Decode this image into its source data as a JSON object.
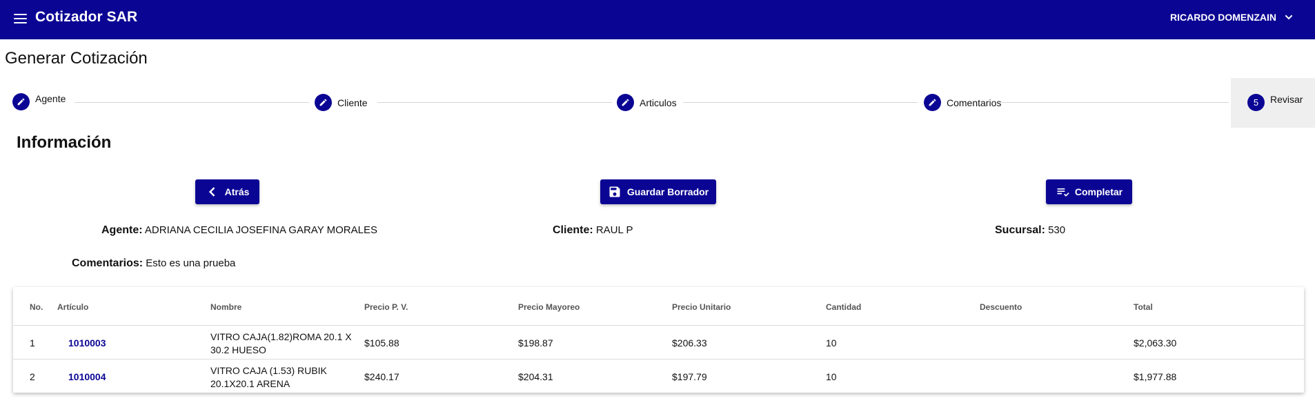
{
  "app": {
    "title": "Cotizador SAR",
    "user": "RICARDO DOMENZAIN"
  },
  "page": {
    "title": "Generar Cotización"
  },
  "stepper": {
    "steps": [
      {
        "label": "Agente"
      },
      {
        "label": "Cliente"
      },
      {
        "label": "Articulos"
      },
      {
        "label": "Comentarios"
      },
      {
        "label": "Revisar",
        "number": "5"
      }
    ]
  },
  "section": {
    "title": "Información"
  },
  "buttons": {
    "back": "Atrás",
    "save_draft": "Guardar Borrador",
    "complete": "Completar"
  },
  "info": {
    "agente_label": "Agente:",
    "agente_value": "ADRIANA CECILIA JOSEFINA GARAY MORALES",
    "cliente_label": "Cliente:",
    "cliente_value": "RAUL P",
    "sucursal_label": "Sucursal:",
    "sucursal_value": "530",
    "comentarios_label": "Comentarios:",
    "comentarios_value": "Esto es una prueba"
  },
  "table": {
    "headers": [
      "No.",
      "Artículo",
      "Nombre",
      "Precio P. V.",
      "Precio Mayoreo",
      "Precio Unitario",
      "Cantidad",
      "Descuento",
      "Total"
    ],
    "rows": [
      {
        "no": "1",
        "articulo": "1010003",
        "nombre_1": "VITRO CAJA(1.82)ROMA 20.1 X",
        "nombre_2": "30.2 HUESO",
        "precio_pv": "$105.88",
        "precio_mayoreo": "$198.87",
        "precio_unitario": "$206.33",
        "cantidad": "10",
        "descuento": "",
        "total": "$2,063.30"
      },
      {
        "no": "2",
        "articulo": "1010004",
        "nombre_1": "VITRO CAJA (1.53) RUBIK",
        "nombre_2": "20.1X20.1 ARENA",
        "precio_pv": "$240.17",
        "precio_mayoreo": "$204.31",
        "precio_unitario": "$197.79",
        "cantidad": "10",
        "descuento": "",
        "total": "$1,977.88"
      }
    ]
  },
  "colors": {
    "primary": "#0b0594",
    "divider": "#dcdcdc",
    "active_step_bg": "#efefef"
  }
}
